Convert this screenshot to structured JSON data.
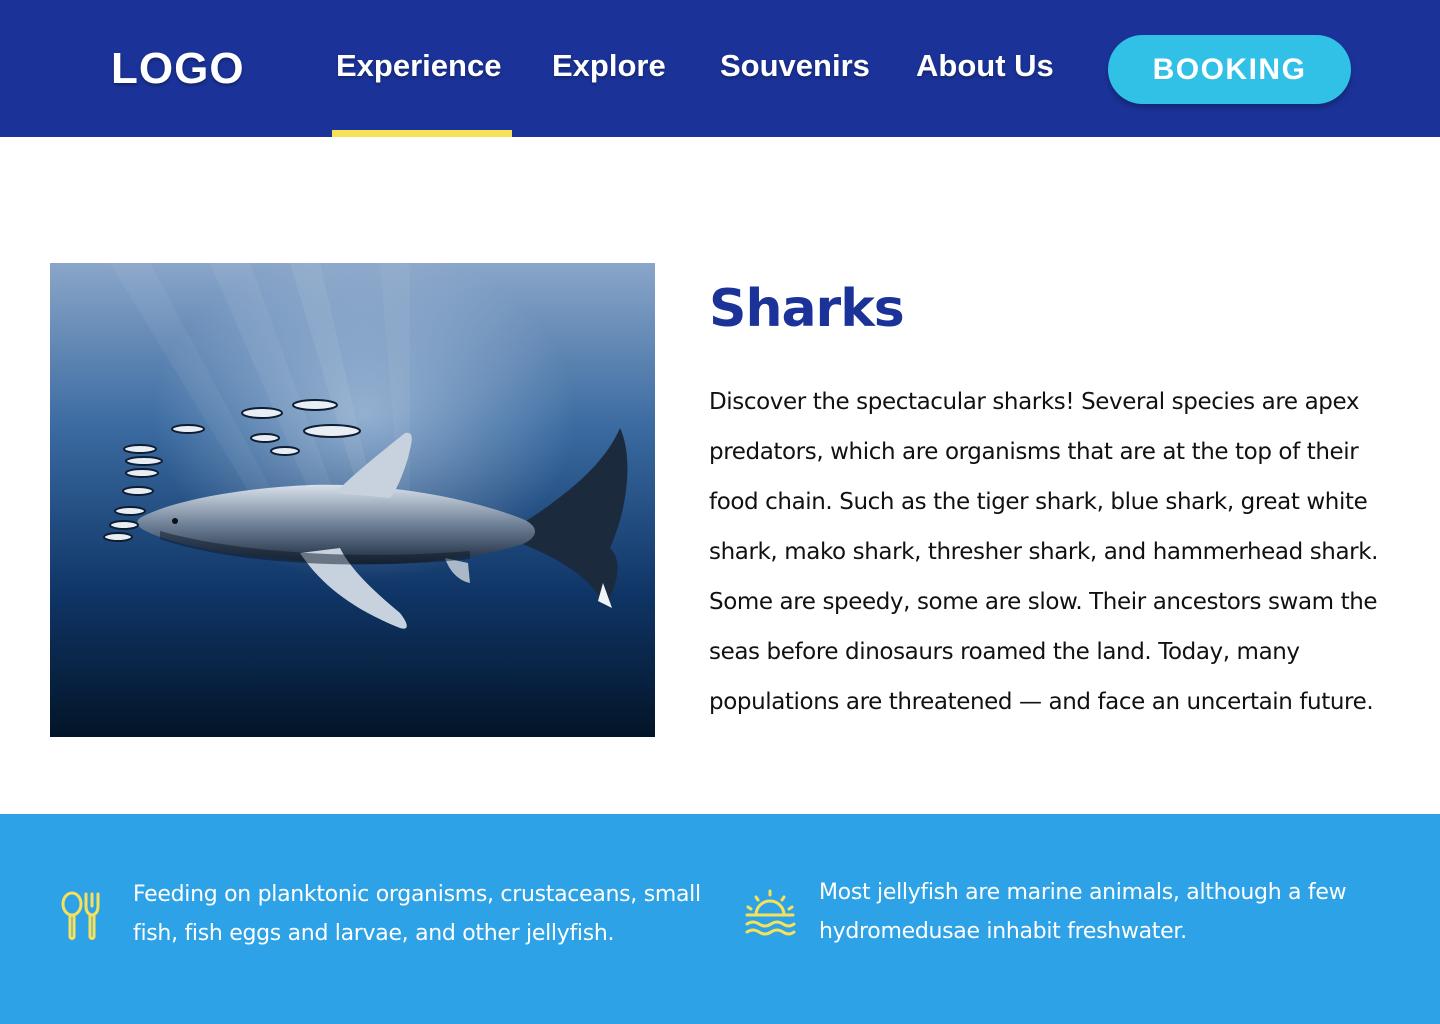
{
  "header": {
    "logo": "LOGO",
    "nav": [
      {
        "label": "Experience",
        "active": true
      },
      {
        "label": "Explore",
        "active": false
      },
      {
        "label": "Souvenirs",
        "active": false
      },
      {
        "label": "About Us",
        "active": false
      }
    ],
    "booking_label": "BOOKING"
  },
  "colors": {
    "header_bg": "#1b3399",
    "accent_underline": "#f7e15a",
    "booking_bg": "#31c0e6",
    "title": "#1b3399",
    "band_bg": "#2ea2e6",
    "icon": "#f7e15a"
  },
  "main": {
    "image_subject": "oceanic whitetip shark with pilot fish",
    "title": "Sharks",
    "description": "Discover the spectacular sharks! Several species are apex predators, which are organisms that are at the top of their food chain. Such as the tiger shark, blue shark, great white shark, mako shark, thresher shark, and hammerhead shark. Some are speedy, some are slow. Their ancestors swam the seas before dinosaurs roamed the land. Today, many populations are threatened — and face an uncertain future."
  },
  "features": [
    {
      "icon": "utensils-icon",
      "text": "Feeding on planktonic organisms, crustaceans, small fish, fish eggs and larvae, and other jellyfish."
    },
    {
      "icon": "sunset-over-water-icon",
      "text": "Most jellyfish are marine animals, although a few hydromedusae inhabit freshwater."
    }
  ]
}
